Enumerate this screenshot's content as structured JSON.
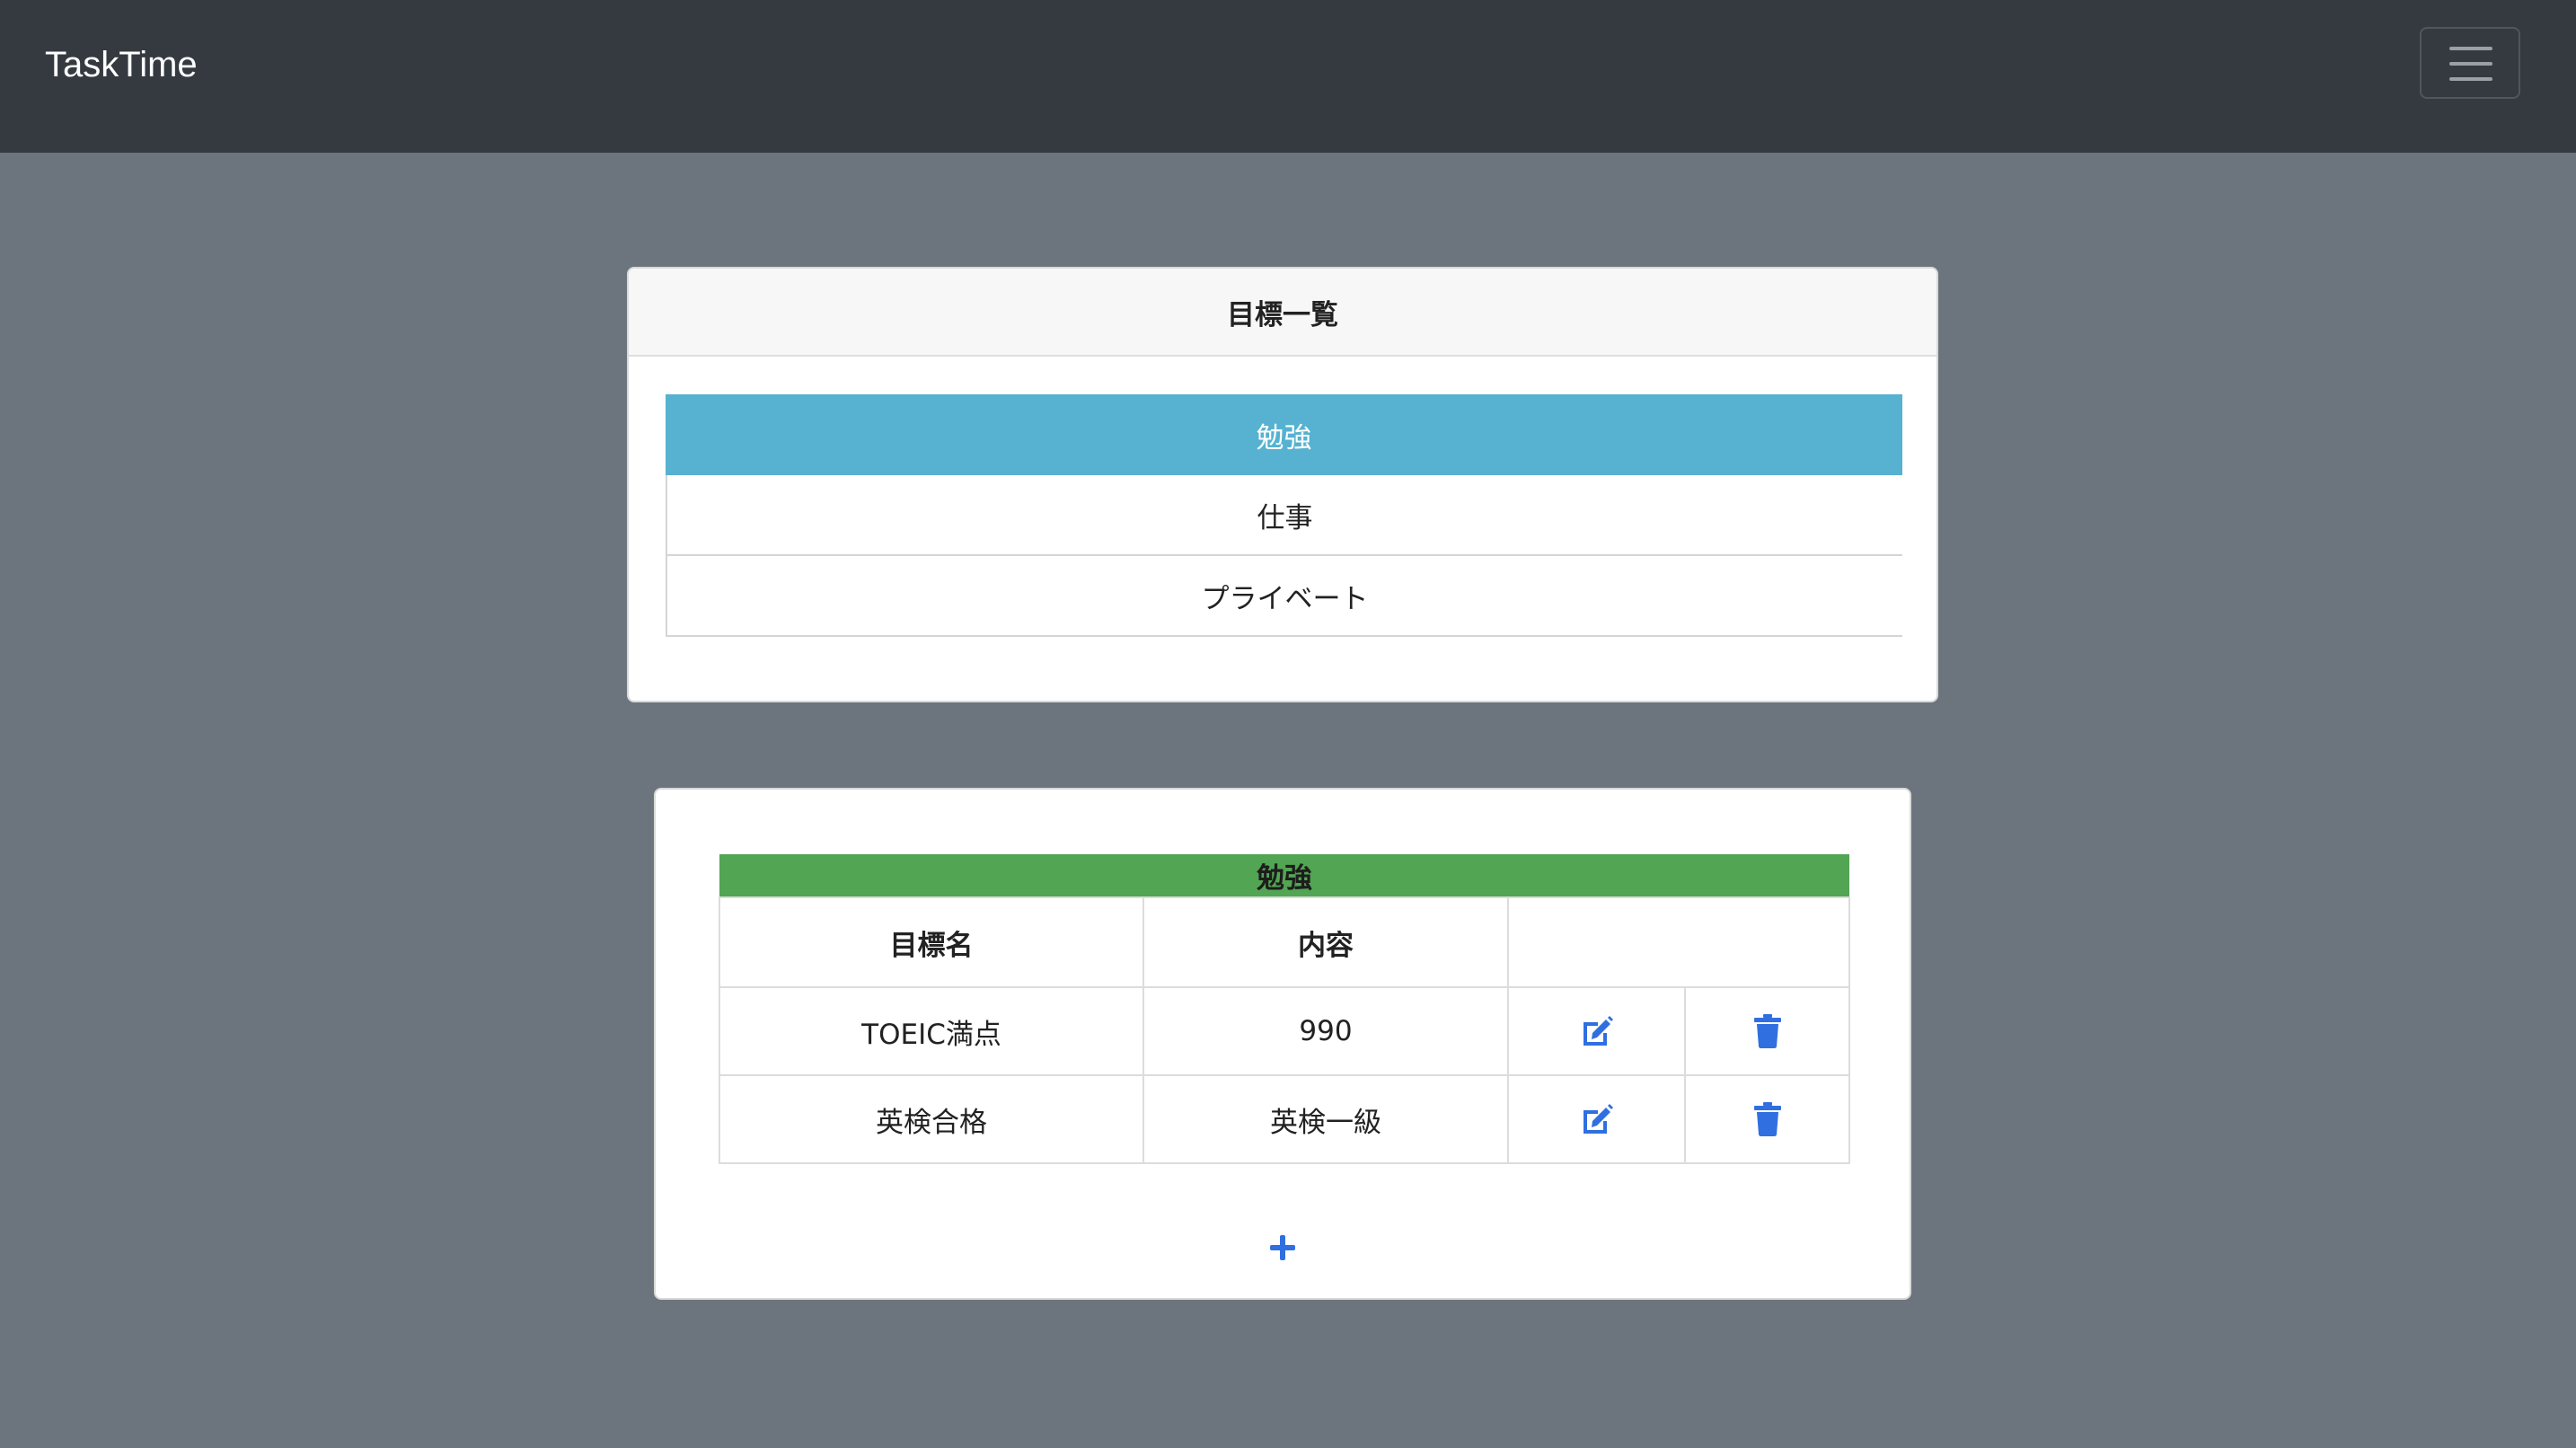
{
  "navbar": {
    "brand": "TaskTime",
    "menu_icon": "hamburger-menu-icon"
  },
  "goals_card": {
    "title": "目標一覧",
    "categories": [
      {
        "label": "勉強",
        "active": true
      },
      {
        "label": "仕事",
        "active": false
      },
      {
        "label": "プライベート",
        "active": false
      }
    ]
  },
  "task_card": {
    "category_title": "勉強",
    "headers": {
      "goal_name": "目標名",
      "content": "内容",
      "actions": ""
    },
    "rows": [
      {
        "goal_name": "TOEIC満点",
        "content": "990",
        "edit_icon": "edit-icon",
        "delete_icon": "trash-icon"
      },
      {
        "goal_name": "英検合格",
        "content": "英検一級",
        "edit_icon": "edit-icon",
        "delete_icon": "trash-icon"
      }
    ],
    "add_icon": "plus-icon"
  },
  "colors": {
    "background": "#6c757d",
    "navbar": "#343a40",
    "active_category": "#56b2d0",
    "table_caption": "#52a552",
    "icon_blue": "#2f6fe0"
  }
}
